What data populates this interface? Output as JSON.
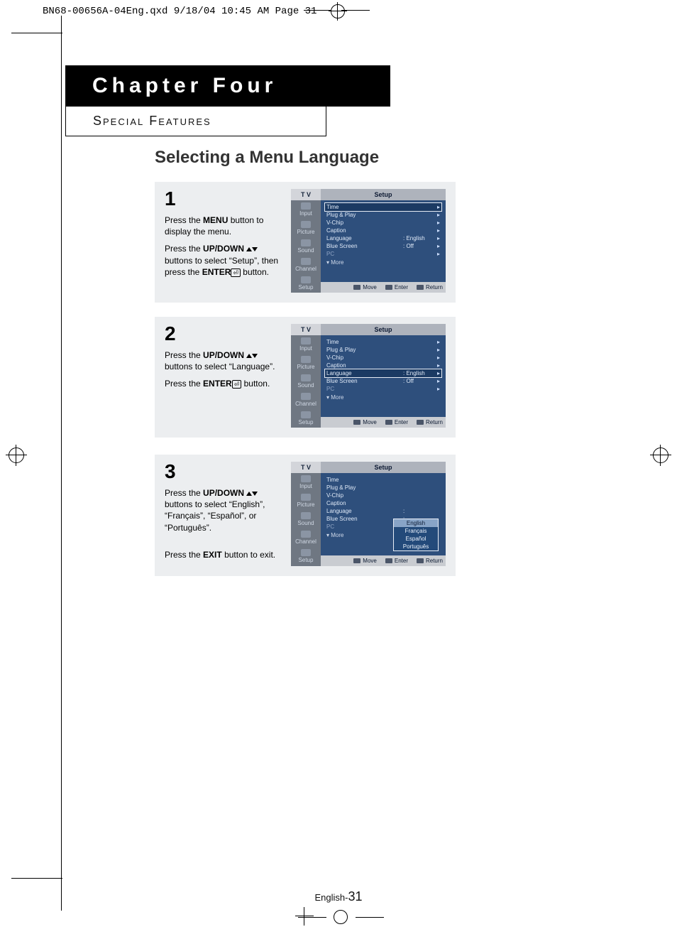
{
  "meta": {
    "slug": "BN68-00656A-04Eng.qxd  9/18/04 10:45 AM  Page 31"
  },
  "header": {
    "chapter": "Chapter Four",
    "sub1": "Special ",
    "sub2": "Features"
  },
  "section": {
    "title": "Selecting a Menu Language"
  },
  "steps": [
    {
      "num": "1",
      "line1a": "Press the",
      "menu": "MENU",
      "line1b": "button to display the menu.",
      "line2a": "Press the",
      "updown": "UP/DOWN",
      "line2b": "buttons to select “Setup”, then press the",
      "enter": "ENTER",
      "line2c": "button."
    },
    {
      "num": "2",
      "line1a": "Press the",
      "updown": "UP/DOWN",
      "line1b": "buttons to select “Language”.",
      "line2a": "Press the",
      "enter": "ENTER",
      "line2b": "button."
    },
    {
      "num": "3",
      "line1a": "Press the",
      "updown": "UP/DOWN",
      "line1b": "buttons to select “English”, “Français”, “Español”, or “Português”.",
      "line2a": "Press the",
      "exit": "EXIT",
      "line2b": "button to exit."
    }
  ],
  "osd": {
    "tv": "T V",
    "title": "Setup",
    "tabs": [
      "Input",
      "Picture",
      "Sound",
      "Channel",
      "Setup"
    ],
    "items": [
      {
        "l": "Time"
      },
      {
        "l": "Plug & Play"
      },
      {
        "l": "V-Chip"
      },
      {
        "l": "Caption"
      },
      {
        "l": "Language",
        "v": ": English"
      },
      {
        "l": "Blue Screen",
        "v": ": Off"
      },
      {
        "l": "PC"
      }
    ],
    "more": "More",
    "foot": [
      "Move",
      "Enter",
      "Return"
    ],
    "lang": [
      "English",
      "Français",
      "Español",
      "Português"
    ]
  },
  "footer": {
    "lang": "English-",
    "page": "31"
  }
}
